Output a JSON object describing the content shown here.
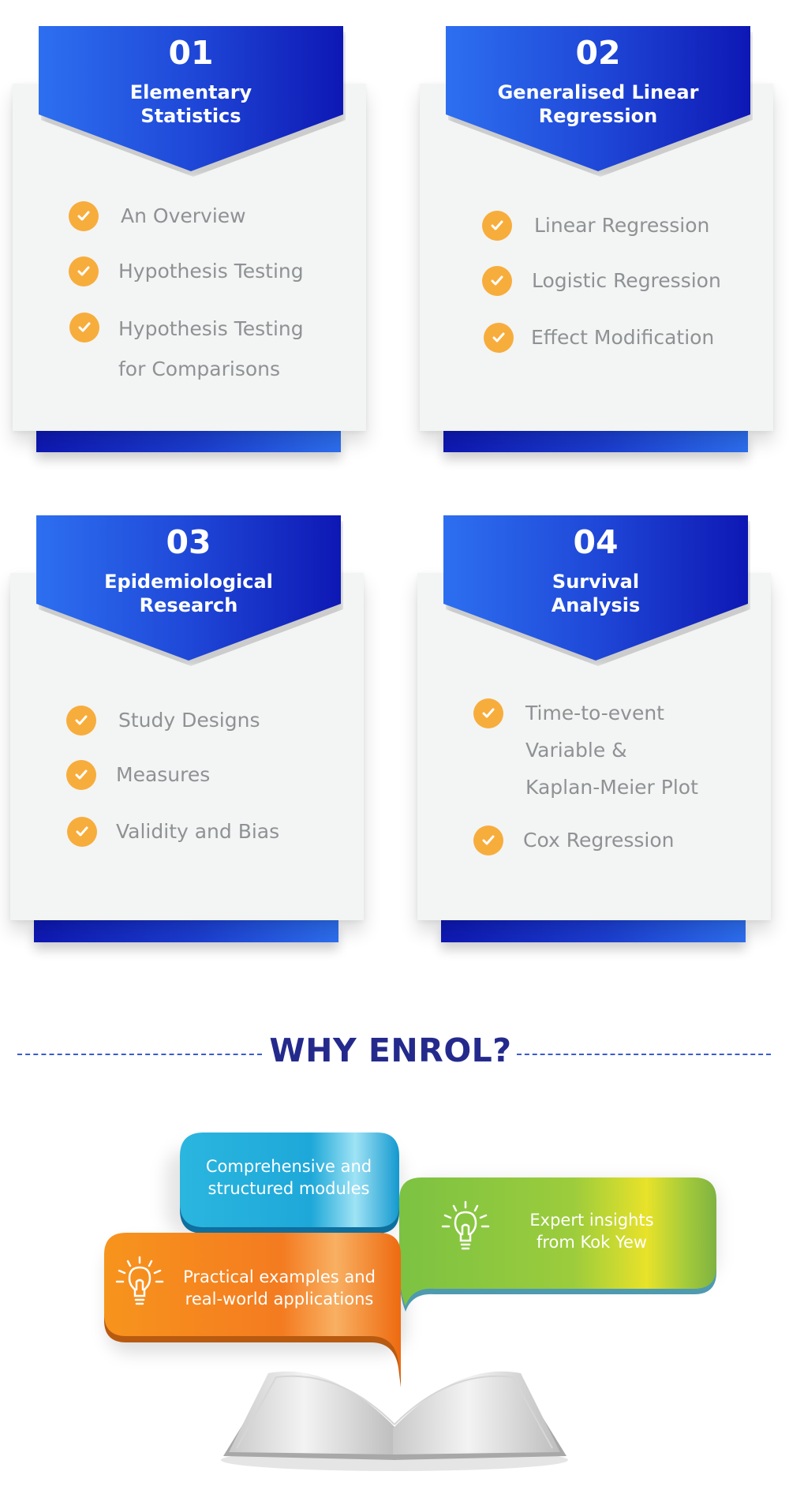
{
  "modules": [
    {
      "number": "01",
      "title": "Elementary\nStatistics",
      "items": [
        "An Overview",
        "Hypothesis Testing",
        "Hypothesis Testing\nfor Comparisons"
      ]
    },
    {
      "number": "02",
      "title": "Generalised Linear\nRegression",
      "items": [
        "Linear Regression",
        "Logistic Regression",
        "Effect Modification"
      ]
    },
    {
      "number": "03",
      "title": "Epidemiological\nResearch",
      "items": [
        "Study Designs",
        "Measures",
        "Validity and Bias"
      ]
    },
    {
      "number": "04",
      "title": "Survival\nAnalysis",
      "items": [
        "Time-to-event\nVariable &\nKaplan-Meier Plot",
        "Cox Regression"
      ]
    }
  ],
  "why": {
    "title": "WHY ENROL?",
    "bubbles": [
      {
        "text": "Comprehensive and\nstructured modules",
        "color": "#22b4dc"
      },
      {
        "text": "Expert insights\nfrom Kok Yew",
        "color": "#8cc63f",
        "icon": "lightbulb-icon"
      },
      {
        "text": "Practical examples and\nreal-world applications",
        "color": "#f47b20",
        "icon": "lightbulb-icon"
      }
    ],
    "illustration": "open-book"
  },
  "colors": {
    "banner_light": "#2d6ff0",
    "banner_dark": "#0e18b4",
    "check": "#f7ad3c",
    "item_text": "#8f9294",
    "card_bg": "#f3f4f4",
    "heading": "#242a8c"
  }
}
